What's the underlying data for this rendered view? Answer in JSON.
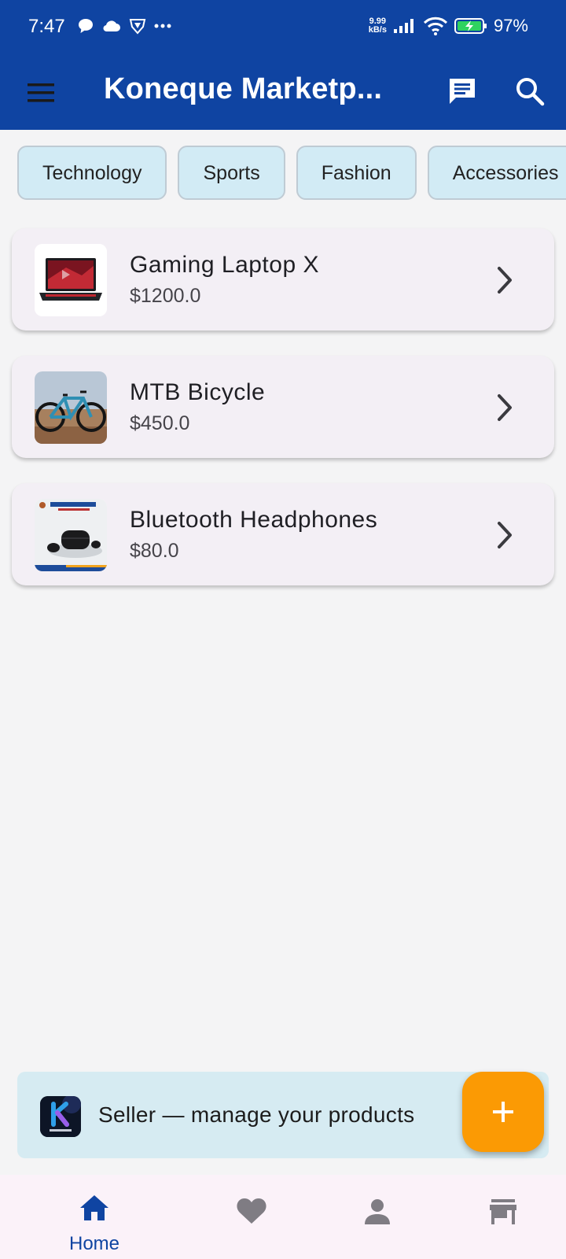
{
  "status_bar": {
    "time": "7:47",
    "speed_value": "9.99",
    "speed_unit": "kB/s",
    "battery": "97%"
  },
  "app_bar": {
    "title": "Koneque Marketp..."
  },
  "categories": [
    "Technology",
    "Sports",
    "Fashion",
    "Accessories"
  ],
  "products": [
    {
      "name": "Gaming Laptop X",
      "price": "$1200.0"
    },
    {
      "name": "MTB Bicycle",
      "price": "$450.0"
    },
    {
      "name": "Bluetooth Headphones",
      "price": "$80.0"
    }
  ],
  "seller_banner": {
    "text": "Seller — manage your products"
  },
  "bottom_nav": {
    "home_label": "Home"
  },
  "colors": {
    "primary": "#0f44a2",
    "fab": "#fb9a04",
    "chip_bg": "#d2ebf5",
    "card_bg": "#f3eff5"
  },
  "icons": [
    "menu-icon",
    "chat-icon",
    "search-icon",
    "chevron-right-icon",
    "plus-icon",
    "home-icon",
    "heart-icon",
    "person-icon",
    "store-icon"
  ]
}
